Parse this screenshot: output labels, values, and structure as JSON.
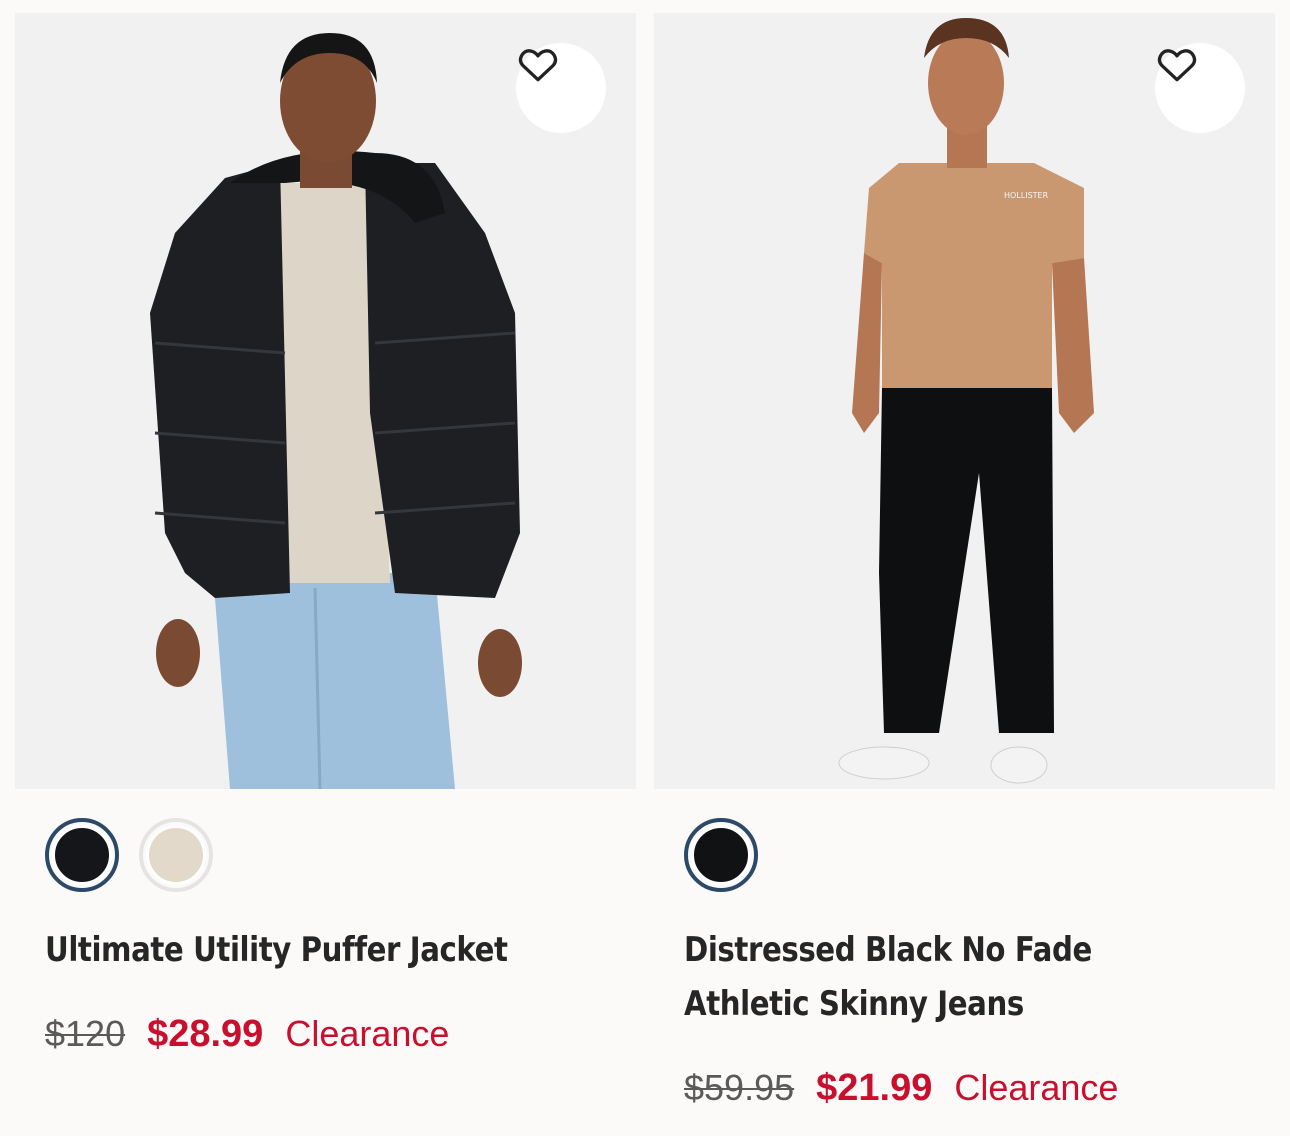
{
  "products": [
    {
      "name": "Ultimate Utility Puffer Jacket",
      "original_price": "$120",
      "sale_price": "$28.99",
      "badge": "Clearance",
      "swatches": [
        {
          "color": "#14161a",
          "selected": true
        },
        {
          "color": "#e2d9cb",
          "selected": false
        }
      ]
    },
    {
      "name": "Distressed Black No Fade Athletic Skinny Jeans",
      "original_price": "$59.95",
      "sale_price": "$21.99",
      "badge": "Clearance",
      "swatches": [
        {
          "color": "#111214",
          "selected": true
        }
      ]
    }
  ],
  "colors": {
    "background": "#fbfaf8",
    "photo_bg": "#f1f1f1",
    "sale": "#c8102e",
    "selected_ring": "#2c4a68"
  },
  "icons": {
    "favorite": "heart-outline-icon"
  }
}
